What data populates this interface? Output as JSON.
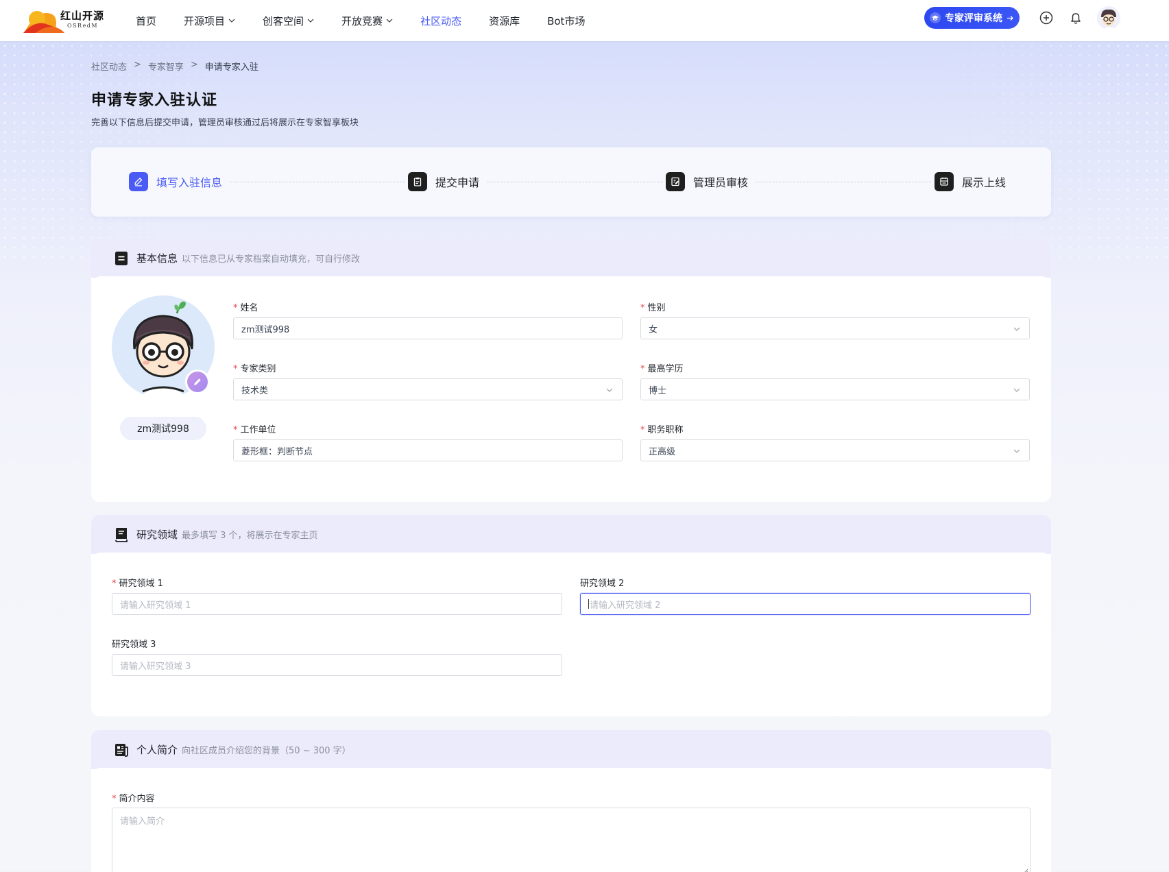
{
  "header": {
    "logo_cn": "红山开源",
    "logo_en": "OSRedM",
    "nav": [
      {
        "label": "首页",
        "has_dropdown": false,
        "active": false
      },
      {
        "label": "开源项目",
        "has_dropdown": true,
        "active": false
      },
      {
        "label": "创客空间",
        "has_dropdown": true,
        "active": false
      },
      {
        "label": "开放竞赛",
        "has_dropdown": true,
        "active": false
      },
      {
        "label": "社区动态",
        "has_dropdown": false,
        "active": true
      },
      {
        "label": "资源库",
        "has_dropdown": false,
        "active": false
      },
      {
        "label": "Bot市场",
        "has_dropdown": false,
        "active": false
      }
    ],
    "expert_button_label": "专家评审系统",
    "icons": [
      "add-circle-icon",
      "bell-icon",
      "user-avatar"
    ]
  },
  "breadcrumb": {
    "items": [
      "社区动态",
      "专家智享",
      "申请专家入驻"
    ],
    "separator": ">"
  },
  "page": {
    "title": "申请专家入驻认证",
    "subtitle": "完善以下信息后提交申请，管理员审核通过后将展示在专家智享板块"
  },
  "steps": [
    {
      "label": "填写入驻信息",
      "icon": "edit-icon",
      "active": true
    },
    {
      "label": "提交申请",
      "icon": "clipboard-icon",
      "active": false
    },
    {
      "label": "管理员审核",
      "icon": "review-icon",
      "active": false
    },
    {
      "label": "展示上线",
      "icon": "publish-icon",
      "active": false
    }
  ],
  "basic_info": {
    "title": "基本信息",
    "desc": "以下信息已从专家档案自动填充，可自行修改",
    "avatar_name": "zm测试998",
    "fields": {
      "name": {
        "label": "姓名",
        "value": "zm测试998",
        "required": true
      },
      "gender": {
        "label": "性别",
        "value": "女",
        "required": true
      },
      "expert_type": {
        "label": "专家类别",
        "value": "技术类",
        "required": true
      },
      "education": {
        "label": "最高学历",
        "value": "博士",
        "required": true
      },
      "employer": {
        "label": "工作单位",
        "value": "菱形框：判断节点",
        "required": true
      },
      "job_title": {
        "label": "职务职称",
        "value": "正高级",
        "required": true
      }
    }
  },
  "research": {
    "title": "研究领域",
    "desc": "最多填写 3 个，将展示在专家主页",
    "fields": {
      "area1": {
        "label": "研究领域 1",
        "placeholder": "请输入研究领域 1",
        "required": true
      },
      "area2": {
        "label": "研究领域 2",
        "placeholder": "请输入研究领域 2",
        "required": false
      },
      "area3": {
        "label": "研究领域 3",
        "placeholder": "请输入研究领域 3",
        "required": false
      }
    }
  },
  "bio": {
    "title": "个人简介",
    "desc": "向社区成员介绍您的背景（50 ~ 300 字）",
    "field": {
      "label": "简介内容",
      "placeholder": "请输入简介",
      "required": true
    }
  },
  "colors": {
    "accent": "#4a5bf5",
    "required": "#e5484d",
    "expert_button": "#2d48f0",
    "section_head": "#ebebfc"
  }
}
